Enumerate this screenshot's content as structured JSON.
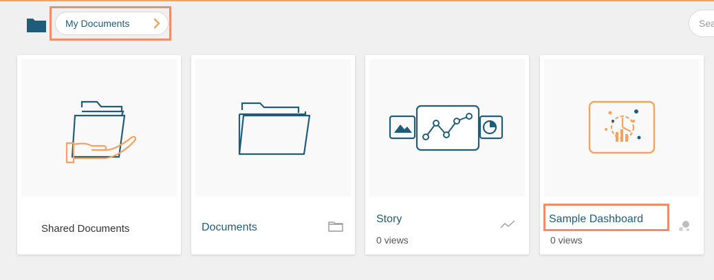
{
  "breadcrumb": {
    "label": "My Documents"
  },
  "search": {
    "placeholder": "Sea"
  },
  "colors": {
    "accent": "#f5a35c",
    "folder": "#1e5c7a",
    "highlight": "#ef8d6a"
  },
  "cards": [
    {
      "title": "Shared Documents",
      "icon": "shared-folder-icon",
      "meta_icon": ""
    },
    {
      "title": "Documents",
      "icon": "folder-icon",
      "meta_icon": "folder-outline-icon"
    },
    {
      "title": "Story",
      "subtitle": "0 views",
      "icon": "story-icon",
      "meta_icon": "line-chart-icon"
    },
    {
      "title": "Sample Dashboard",
      "subtitle": "0 views",
      "icon": "dashboard-icon",
      "meta_icon": "bubble-icon"
    }
  ]
}
